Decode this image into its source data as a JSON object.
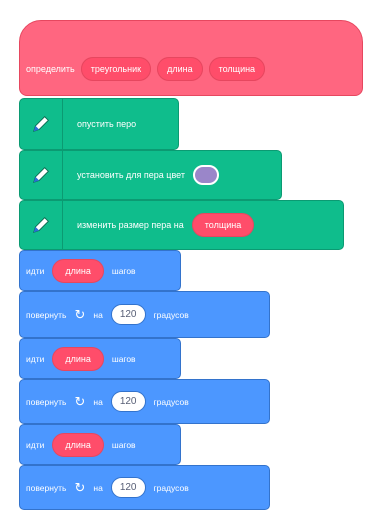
{
  "hat": {
    "label": "определить",
    "params": [
      "треугольник",
      "длина",
      "толщина"
    ]
  },
  "pen_blocks": [
    {
      "text": "опустить перо"
    },
    {
      "text": "установить для пера цвет",
      "color_value": "#9a86c9"
    },
    {
      "text": "изменить размер пера на",
      "param": "толщина"
    }
  ],
  "motion_blocks": [
    {
      "type": "move",
      "prefix": "идти",
      "param": "длина",
      "suffix": "шагов"
    },
    {
      "type": "turn",
      "prefix": "повернуть",
      "value": "120",
      "suffix": "градусов"
    },
    {
      "type": "move",
      "prefix": "идти",
      "param": "длина",
      "suffix": "шагов"
    },
    {
      "type": "turn",
      "prefix": "повернуть",
      "value": "120",
      "suffix": "градусов"
    },
    {
      "type": "move",
      "prefix": "идти",
      "param": "длина",
      "suffix": "шагов"
    },
    {
      "type": "turn",
      "prefix": "повернуть",
      "value": "120",
      "suffix": "градусов"
    }
  ],
  "colors": {
    "hat": "#ff6680",
    "pen": "#0fbd8c",
    "motion": "#4c97ff",
    "reporter": "#ff4d6a"
  },
  "icons": {
    "pen_icon": "pen-icon",
    "turn_icon": "rotate-right-icon"
  }
}
